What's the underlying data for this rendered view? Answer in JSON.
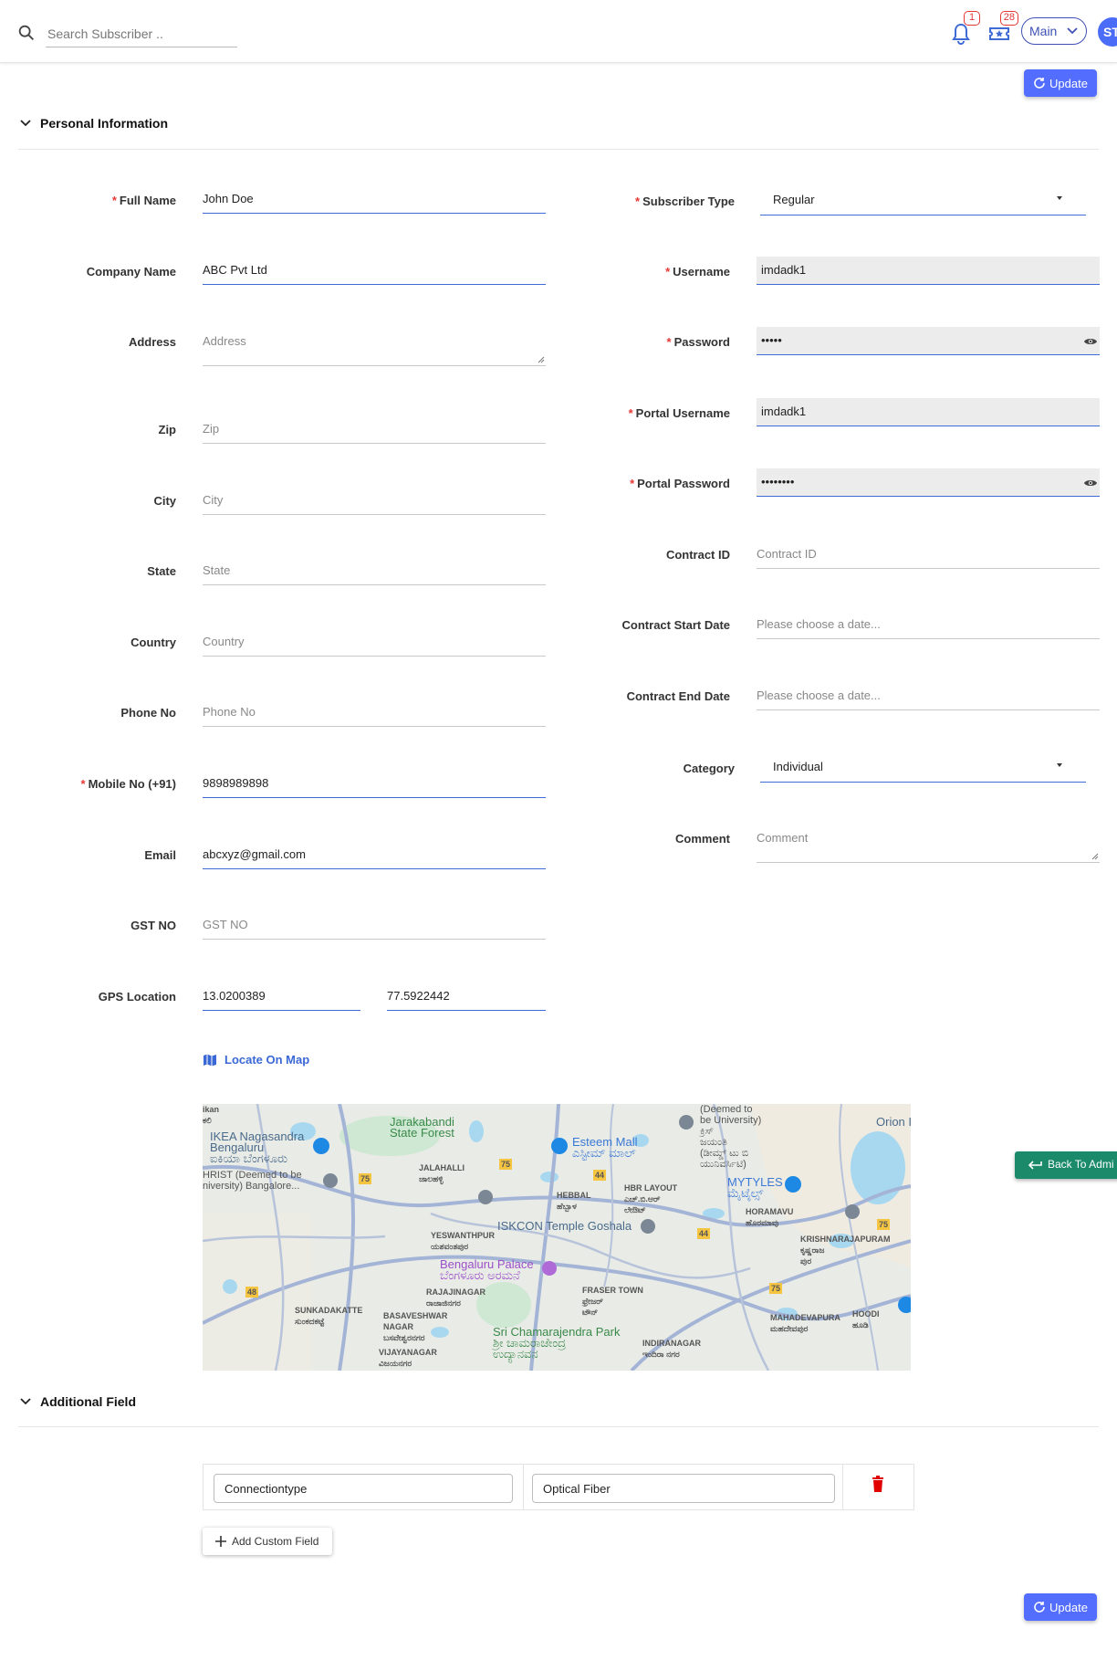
{
  "search": {
    "placeholder": "Search Subscriber .."
  },
  "header": {
    "notifications_count": "1",
    "tickets_count": "28",
    "branch": "Main",
    "avatar_initials": "ST"
  },
  "actions": {
    "update_label": "Update"
  },
  "sections": {
    "personal": "Personal Information",
    "additional": "Additional Field"
  },
  "left_fields": {
    "full_name": {
      "label": "Full Name",
      "value": "John Doe"
    },
    "company_name": {
      "label": "Company Name",
      "value": "ABC Pvt Ltd"
    },
    "address": {
      "label": "Address",
      "placeholder": "Address"
    },
    "zip": {
      "label": "Zip",
      "placeholder": "Zip"
    },
    "city": {
      "label": "City",
      "placeholder": "City"
    },
    "state": {
      "label": "State",
      "placeholder": "State"
    },
    "country": {
      "label": "Country",
      "placeholder": "Country"
    },
    "phone": {
      "label": "Phone No",
      "placeholder": "Phone No"
    },
    "mobile": {
      "label": "Mobile No (+91)",
      "value": "9898989898"
    },
    "email": {
      "label": "Email",
      "value": "abcxyz@gmail.com"
    },
    "gst": {
      "label": "GST NO",
      "placeholder": "GST NO"
    },
    "gps": {
      "label": "GPS Location",
      "lat": "13.0200389",
      "lng": "77.5922442"
    }
  },
  "right_fields": {
    "subscriber_type": {
      "label": "Subscriber Type",
      "value": "Regular"
    },
    "username": {
      "label": "Username",
      "value": "imdadk1"
    },
    "password": {
      "label": "Password",
      "value": "•••••"
    },
    "portal_username": {
      "label": "Portal Username",
      "value": "imdadk1"
    },
    "portal_password": {
      "label": "Portal Password",
      "value": "••••••••"
    },
    "contract_id": {
      "label": "Contract ID",
      "placeholder": "Contract ID"
    },
    "contract_start": {
      "label": "Contract Start Date",
      "placeholder": "Please choose a date..."
    },
    "contract_end": {
      "label": "Contract End Date",
      "placeholder": "Please choose a date..."
    },
    "category": {
      "label": "Category",
      "value": "Individual"
    },
    "comment": {
      "label": "Comment",
      "placeholder": "Comment"
    }
  },
  "map": {
    "locate_label": "Locate On Map",
    "labels": {
      "kan": "ikan\nಕಲಿ",
      "ikea": "IKEA Nagasandra\nBengaluru\nಐಕಿಯಾ ಬೆಂಗಳೂರು",
      "jarakabandi": "Jarakabandi\nState Forest",
      "esteem": "Esteem Mall\nಎಸ್ಟೀಮ್ ಮಾಲ್",
      "deemed": "(Deemed to\nbe University)\nಕ್ರಿಸ್\nಜಯಂತಿ\n(ಡೀಮ್ಡ್ ಟು ಬಿ\nಯುನಿವರ್ಸಿಟಿ)",
      "orion": "Orion I",
      "christ": "HRIST (Deemed to be\nniversity) Bangalore...",
      "jalahalli": "JALAHALLI\nಜಾಲಹಳ್ಳಿ",
      "hebbal": "HEBBAL\nಹೆಬ್ಬಾಳ",
      "hbr": "HBR LAYOUT\nಎಚ್.ಬಿ.ಆರ್\nಲೇಔಟ್",
      "mytyles": "MYTYLES\nಮೈಟೈಲ್ಸ್",
      "horamavu": "HORAMAVU\nಹೊರಮಾವು",
      "iskcon": "ISKCON Temple Goshala",
      "yeswanthpur": "YESWANTHPUR\nಯಶವಂತಪುರ",
      "krishnarajapuram": "KRISHNARAJAPURAM\nಕೃಷ್ಣರಾಜ\nಪುರ",
      "palace": "Bengaluru Palace\nಬೆಂಗಳೂರು ಅರಮನೆ",
      "rajajinagar": "RAJAJINAGAR\nರಾಜಾಜಿನಗರ",
      "frasertown": "FRASER TOWN\nಫ್ರೇಜರ್\nಟೌನ್",
      "sunkadakatte": "SUNKADAKATTE\nಸುಂಕದಕಟ್ಟೆ",
      "basaveshwar": "BASAVESHWAR\nNAGAR\nಬಸವೇಶ್ವರನಗರ",
      "chamarajendra": "Sri Chamarajendra Park\nಶ್ರೀ ಚಾಮರಾಜೇಂದ್ರ\nಉದ್ಯಾನವನ",
      "indiranagar": "INDIRANAGAR\nಇಂದಿರಾ ನಗರ",
      "mahadevapura": "MAHADEVAPURA\nಮಹದೇವಪುರ",
      "hoodi": "HOODI\nಹೂಡಿ",
      "vijayanagar": "VIJAYANAGAR\nವಿಜಯನಗರ",
      "road_75a": "75",
      "road_75b": "75",
      "road_44a": "44",
      "road_44b": "44",
      "road_48": "48",
      "road_75c": "75",
      "road_75d": "75"
    }
  },
  "back_to_admin": "Back To Admi",
  "custom_fields": [
    {
      "key": "Connectiontype",
      "value": "Optical Fiber"
    }
  ],
  "add_custom_field_label": "Add Custom Field",
  "colors": {
    "accent": "#536dfe",
    "required": "#e53935",
    "link": "#3a68d6",
    "back_button": "#1a8a6a",
    "delete": "#e00000"
  }
}
